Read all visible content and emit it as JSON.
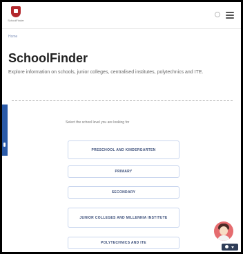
{
  "header": {
    "logo_label": "SchoolFinder"
  },
  "breadcrumb": "Home",
  "page": {
    "title": "SchoolFinder",
    "description": "Explore information on schools, junior colleges, centralised institutes, polytechnics and ITE."
  },
  "selector": {
    "prompt": "Select the school level you are looking for",
    "levels": [
      {
        "label": "PRESCHOOL AND KINDERGARTEN"
      },
      {
        "label": "PRIMARY"
      },
      {
        "label": "SECONDARY"
      },
      {
        "label": "JUNIOR COLLEGES AND MILLENNIA INSTITUTE"
      },
      {
        "label": "POLYTECHNICS AND ITE"
      }
    ]
  },
  "colors": {
    "brand": "#b3282d",
    "accent": "#2a5aa8",
    "button_text": "#3c4f7a",
    "button_border": "#c9d6ee"
  }
}
